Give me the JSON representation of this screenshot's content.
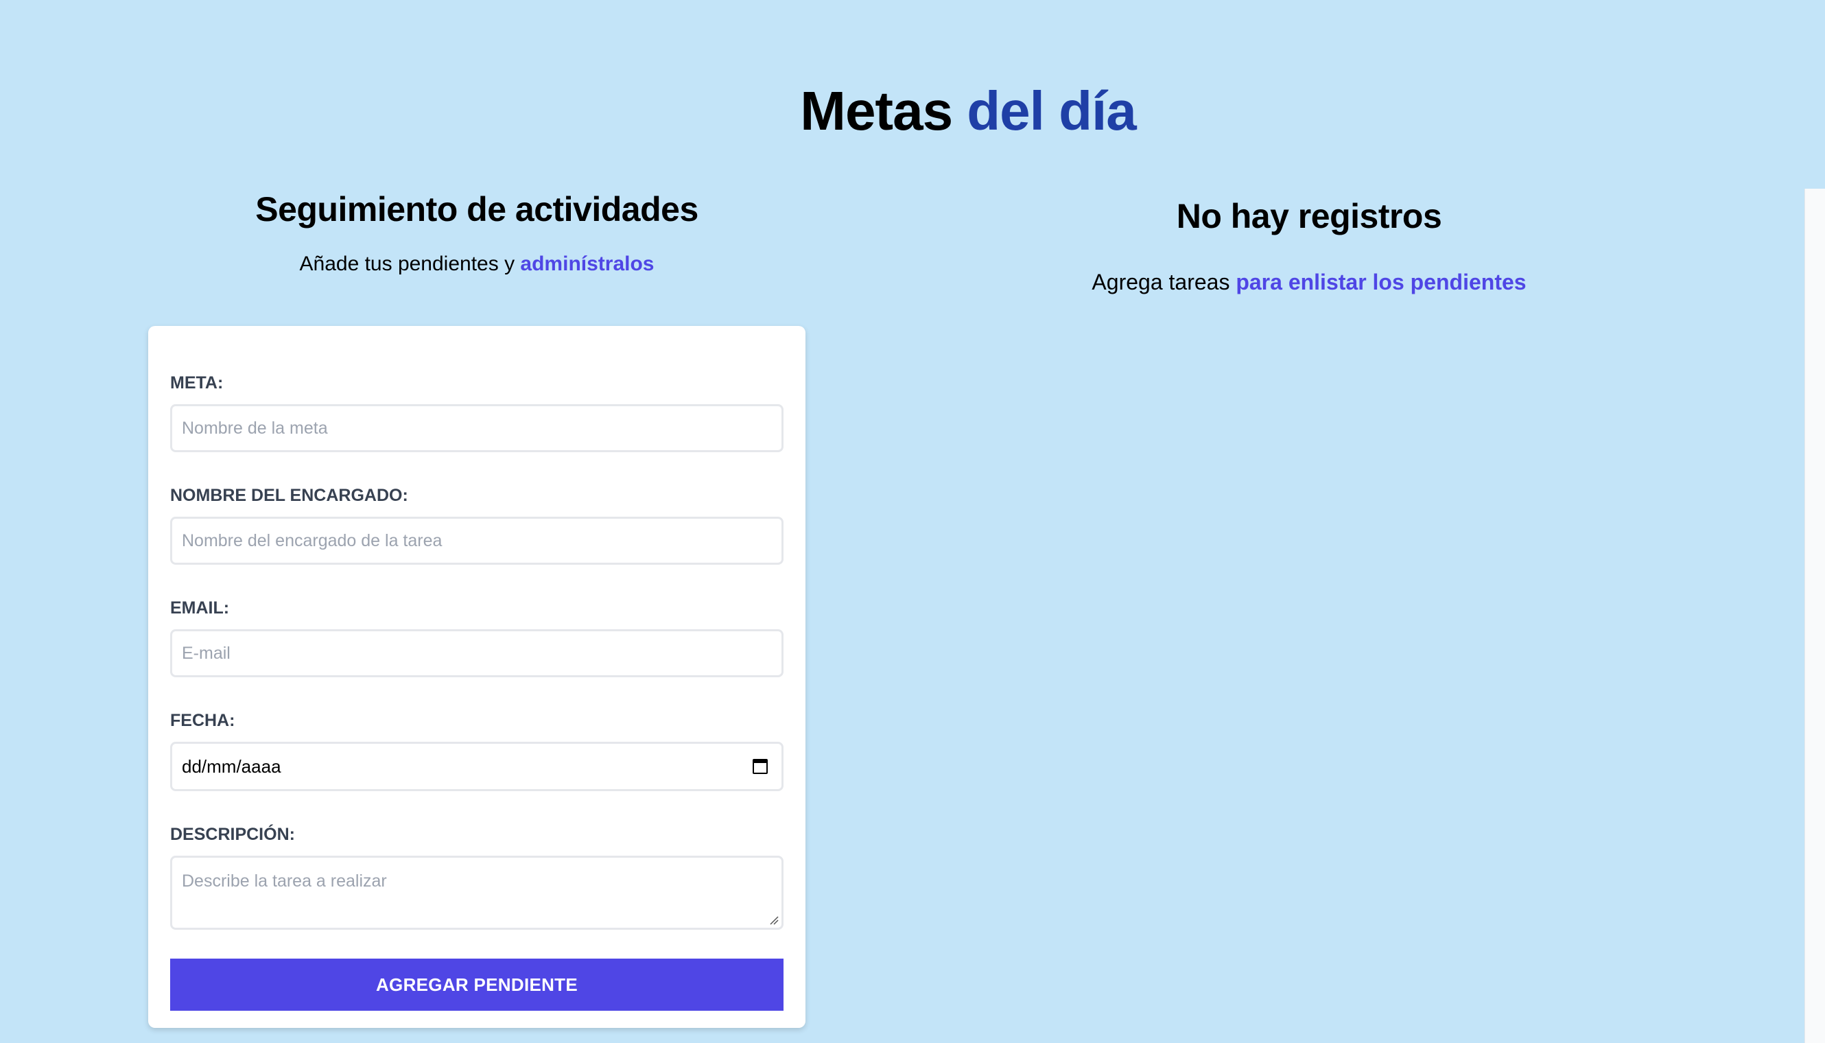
{
  "header": {
    "title_main": "Metas",
    "title_accent": "del día"
  },
  "form_section": {
    "title": "Seguimiento de actividades",
    "subtitle_text": "Añade tus pendientes y",
    "subtitle_accent": "adminístralos"
  },
  "list_section": {
    "title": "No hay registros",
    "subtitle_text": "Agrega tareas",
    "subtitle_accent": "para enlistar los pendientes"
  },
  "form": {
    "meta": {
      "label": "META:",
      "placeholder": "Nombre de la meta"
    },
    "encargado": {
      "label": "NOMBRE DEL ENCARGADO:",
      "placeholder": "Nombre del encargado de la tarea"
    },
    "email": {
      "label": "EMAIL:",
      "placeholder": "E-mail"
    },
    "fecha": {
      "label": "FECHA:",
      "placeholder": "dd/mm/aaaa"
    },
    "descripcion": {
      "label": "DESCRIPCIÓN:",
      "placeholder": "Describe la tarea a realizar"
    },
    "submit_label": "AGREGAR PENDIENTE"
  },
  "colors": {
    "background": "#c3e4f8",
    "accent_title": "#1f3fa6",
    "accent": "#4f46e5"
  },
  "icons": {
    "date": "calendar-icon",
    "textarea": "resize-handle-icon"
  }
}
